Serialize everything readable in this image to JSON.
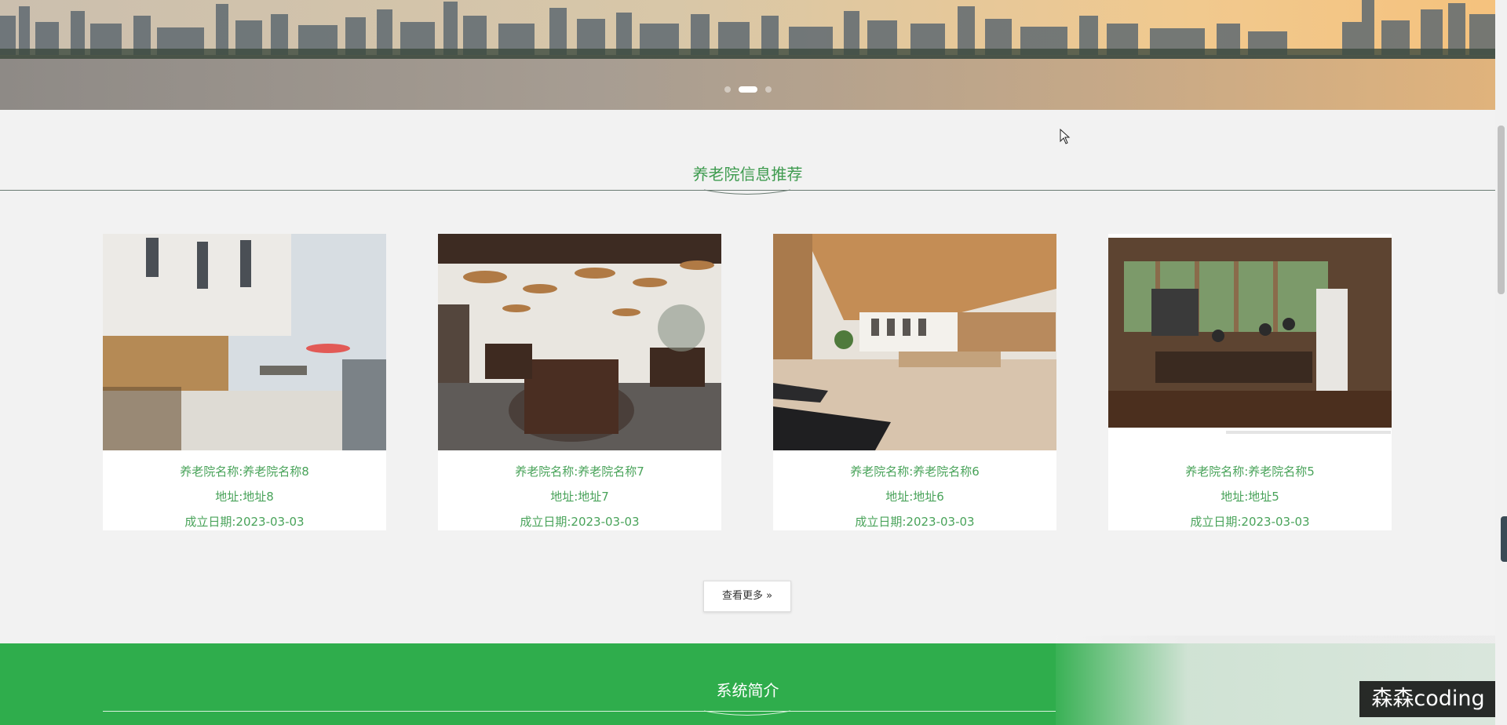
{
  "banner": {
    "slides": 3,
    "active_slide": 2
  },
  "recommend": {
    "title": "养老院信息推荐",
    "cards": [
      {
        "name": "养老院名称:养老院名称8",
        "address": "地址:地址8",
        "date": "成立日期:2023-03-03",
        "image": "terrace-photo"
      },
      {
        "name": "养老院名称:养老院名称7",
        "address": "地址:地址7",
        "date": "成立日期:2023-03-03",
        "image": "dining-hall-photo"
      },
      {
        "name": "养老院名称:养老院名称6",
        "address": "地址:地址6",
        "date": "成立日期:2023-03-03",
        "image": "gym-photo"
      },
      {
        "name": "养老院名称:养老院名称5",
        "address": "地址:地址5",
        "date": "成立日期:2023-03-03",
        "image": "activity-room-photo"
      }
    ],
    "more_label": "查看更多 »"
  },
  "intro": {
    "title": "系统简介"
  },
  "watermark": "森森coding",
  "colors": {
    "accent": "#3e9b4f",
    "green_band": "#2fad4c"
  }
}
